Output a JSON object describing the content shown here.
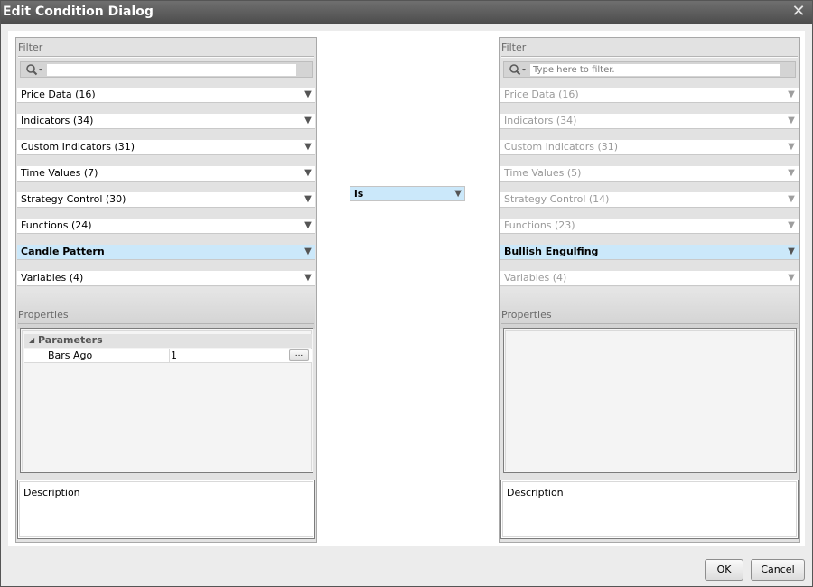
{
  "dialog": {
    "title": "Edit Condition Dialog",
    "close_glyph": "✕",
    "ok_label": "OK",
    "cancel_label": "Cancel"
  },
  "left": {
    "filter_label": "Filter",
    "filter_value": "",
    "filter_placeholder": "",
    "categories": [
      {
        "label": "Price Data (16)"
      },
      {
        "label": "Indicators (34)"
      },
      {
        "label": "Custom Indicators (31)"
      },
      {
        "label": "Time Values (7)"
      },
      {
        "label": "Strategy Control (30)"
      },
      {
        "label": "Functions (24)"
      },
      {
        "label": "Candle Pattern",
        "selected": true
      },
      {
        "label": "Variables (4)"
      }
    ],
    "properties_label": "Properties",
    "parameters_category": "Parameters",
    "parameters": [
      {
        "name": "Bars Ago",
        "value": "1",
        "button": "..."
      }
    ],
    "description_label": "Description"
  },
  "operator": {
    "value": "is"
  },
  "right": {
    "filter_label": "Filter",
    "filter_value": "",
    "filter_placeholder": "Type here to filter.",
    "categories": [
      {
        "label": "Price Data (16)"
      },
      {
        "label": "Indicators (34)"
      },
      {
        "label": "Custom Indicators (31)"
      },
      {
        "label": "Time Values (5)"
      },
      {
        "label": "Strategy Control (14)"
      },
      {
        "label": "Functions (23)"
      },
      {
        "label": "Bullish Engulfing",
        "selected": true
      },
      {
        "label": "Variables (4)"
      }
    ],
    "properties_label": "Properties",
    "description_label": "Description"
  },
  "icons": {
    "search": "magnifier-dropdown-icon",
    "dropdown": "▼",
    "collapse": "◢"
  },
  "colors": {
    "selection": "#cbe8fa",
    "titlebar": "#5b5b5b",
    "disabled_text": "#9a9a9a"
  }
}
